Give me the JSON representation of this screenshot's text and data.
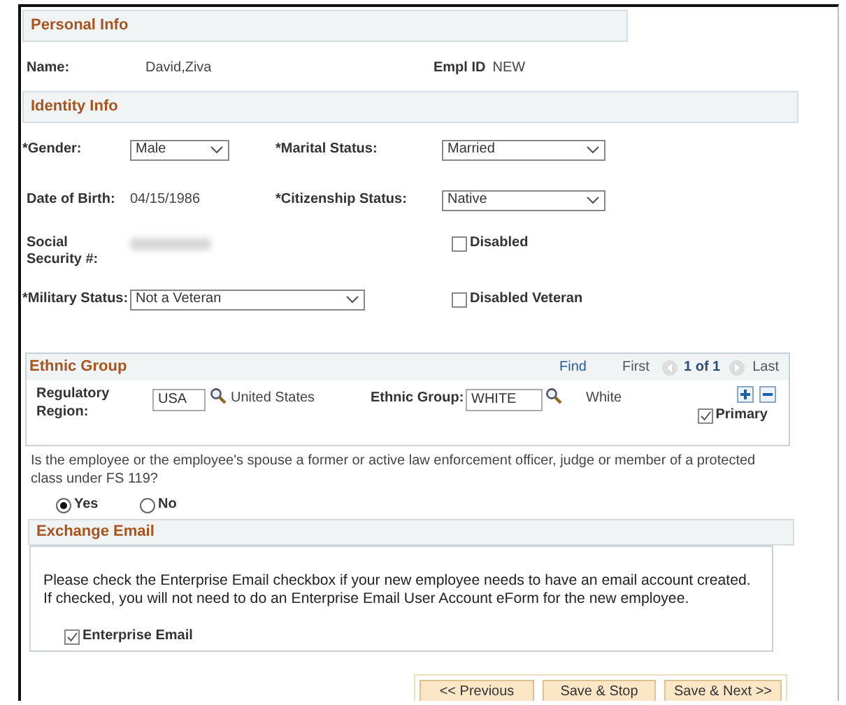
{
  "personal_info": {
    "title": "Personal Info",
    "name_label": "Name:",
    "name": "David,Ziva",
    "empl_id_label": "Empl ID",
    "empl_id": "NEW"
  },
  "identity_info": {
    "title": "Identity Info",
    "gender": {
      "label": "*Gender:",
      "value": "Male"
    },
    "marital_status": {
      "label": "*Marital Status:",
      "value": "Married"
    },
    "date_of_birth": {
      "label": "Date of Birth:",
      "value": "04/15/1986"
    },
    "citizenship_status": {
      "label": "*Citizenship Status:",
      "value": "Native"
    },
    "ssn": {
      "label": "Social Security #:"
    },
    "disabled": {
      "label": "Disabled",
      "checked": false
    },
    "military_status": {
      "label": "*Military Status:",
      "value": "Not a Veteran"
    },
    "disabled_veteran": {
      "label": "Disabled Veteran",
      "checked": false
    }
  },
  "ethnic_group": {
    "title": "Ethnic Group",
    "find": "Find",
    "first": "First",
    "count": "1 of 1",
    "last": "Last",
    "regulatory_region": {
      "label": "Regulatory Region:",
      "value": "USA",
      "description": "United States"
    },
    "group": {
      "label": "Ethnic Group:",
      "value": "WHITE",
      "description": "White"
    },
    "primary": {
      "label": "Primary",
      "checked": true
    }
  },
  "question": {
    "text": "Is the employee or the employee's spouse a former or active law enforcement officer, judge or member of a protected class under FS 119?",
    "options": [
      {
        "label": "Yes",
        "selected": true
      },
      {
        "label": "No",
        "selected": false
      }
    ]
  },
  "exchange_email": {
    "title": "Exchange Email",
    "message": [
      "Please check the Enterprise Email checkbox if your new employee needs to have an email account created.",
      "If checked, you will not need to do an Enterprise Email User Account eForm for the new employee."
    ],
    "enterprise_email": {
      "label": "Enterprise Email",
      "checked": true
    }
  },
  "buttons": [
    "<< Previous",
    "Save & Stop",
    "Save & Next >>"
  ]
}
